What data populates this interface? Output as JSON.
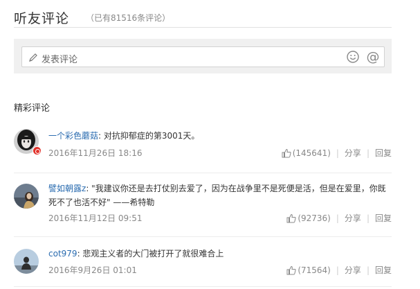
{
  "header": {
    "title": "听友评论",
    "count": "（已有81516条评论）"
  },
  "compose": {
    "placeholder": "发表评论",
    "emoji_icon": "smile-icon",
    "at_icon": "at-icon"
  },
  "section_title": "精彩评论",
  "comments": [
    {
      "user": "一个彩色蘑菇",
      "text": ": 对抗抑郁症的第3001天。",
      "time": "2016年11月26日 18:16",
      "likes": "(145641)",
      "share": "分享",
      "reply": "回复"
    },
    {
      "user": "譬如朝露z",
      "text": ": \"我建议你还是去打仗别去爱了，因为在战争里不是死便是活，但是在爱里，你既死不了也活不好\" ——希特勒",
      "time": "2016年11月12日 09:51",
      "likes": "(92736)",
      "share": "分享",
      "reply": "回复"
    },
    {
      "user": "cot979",
      "text": ": 悲观主义者的大门被打开了就很难合上",
      "time": "2016年9月26日 01:01",
      "likes": "(71564)",
      "share": "分享",
      "reply": "回复"
    }
  ],
  "colors": {
    "link": "#2b6cb0",
    "meta": "#888888",
    "badge": "#e2322b"
  }
}
